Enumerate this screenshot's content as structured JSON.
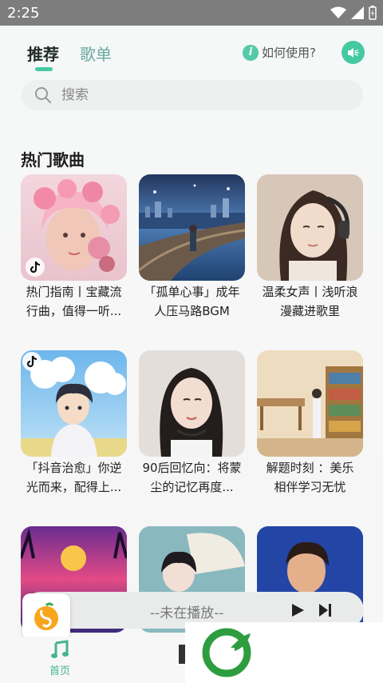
{
  "status": {
    "time": "2:25"
  },
  "tabs": [
    {
      "label": "推荐",
      "active": true
    },
    {
      "label": "歌单",
      "active": false
    }
  ],
  "help": {
    "label": "如何使用?",
    "icon": "info-icon"
  },
  "sound": {
    "icon": "speaker-icon"
  },
  "search": {
    "placeholder": "搜索",
    "value": ""
  },
  "section": {
    "title": "热门歌曲"
  },
  "cards": [
    {
      "caption": "热门指南丨宝藏流\n行曲，值得一听...",
      "cover": "pink-flower-girl",
      "badge": "tiktok"
    },
    {
      "caption": "「孤单心事」成年\n人压马路BGM",
      "cover": "night-city-boy",
      "badge": ""
    },
    {
      "caption": "温柔女声丨浅听浪\n漫藏进歌里",
      "cover": "headphone-girl",
      "badge": ""
    },
    {
      "caption": "「抖音治愈」你逆\n光而来，配得上...",
      "cover": "anime-boy-sky",
      "badge": "tiktok"
    },
    {
      "caption": "90后回忆向：将蒙\n尘的记忆再度...",
      "cover": "headset-woman",
      "badge": ""
    },
    {
      "caption": "解题时刻 ：美乐\n相伴学习无忧",
      "cover": "library-girl",
      "badge": ""
    },
    {
      "caption": "",
      "cover": "sunset-palms",
      "badge": ""
    },
    {
      "caption": "",
      "cover": "umbrella-girl",
      "badge": ""
    },
    {
      "caption": "",
      "cover": "retro-man",
      "badge": ""
    }
  ],
  "player": {
    "status": "--未在播放--"
  },
  "nav": [
    {
      "label": "首页",
      "active": true
    }
  ],
  "colors": {
    "accent": "#45c9a1",
    "statusbar": "#7d7d7d"
  }
}
